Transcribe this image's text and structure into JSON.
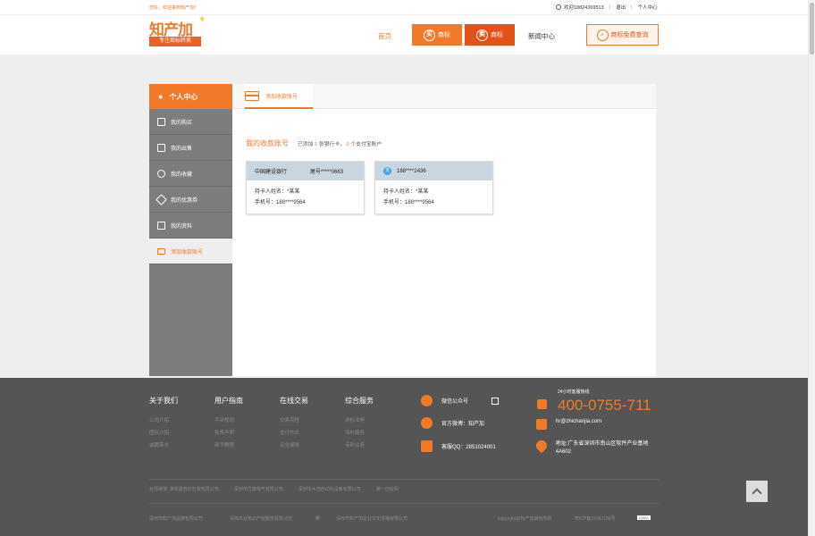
{
  "topbar": {
    "greeting": "您好，欢迎来到知产加！",
    "user_phone": "欢迎18824369513",
    "logout": "退出",
    "personal_center": "个人中心"
  },
  "header": {
    "logo_text": "知产加",
    "logo_slogan": "专注商标转卖",
    "nav_home": "首页",
    "buy_trademark": "商标",
    "buy_icon": "买",
    "sell_trademark": "商标",
    "sell_icon": "卖",
    "news": "新闻中心",
    "free_query": "商标免费查询"
  },
  "sidebar": {
    "title": "个人中心",
    "items": [
      {
        "label": "我的购买",
        "icon": "cart-icon"
      },
      {
        "label": "我的出售",
        "icon": "sell-icon"
      },
      {
        "label": "我的收藏",
        "icon": "heart-icon"
      },
      {
        "label": "我的优惠券",
        "icon": "coupon-icon"
      },
      {
        "label": "我的资料",
        "icon": "profile-icon"
      },
      {
        "label": "添加收款账号",
        "icon": "card-icon"
      }
    ]
  },
  "main": {
    "tab_label": "添加收款账号",
    "account_title": "我的收款账号",
    "summary_prefix": "已添加",
    "bank_count": "1",
    "summary_mid": "张银行卡，",
    "alipay_count": "0",
    "summary_suffix": "个支付宝账户",
    "cards": [
      {
        "bank": "中国建设银行",
        "number": "尾号*****0663",
        "holder": "持卡人姓名：*某某",
        "phone": "手机号：188****9564"
      },
      {
        "bank": "",
        "number": "188****2436",
        "holder": "持卡人姓名：*某某",
        "phone": "手机号：188****9564"
      }
    ]
  },
  "footer": {
    "columns": [
      {
        "title": "关于我们",
        "items": [
          "公司介绍",
          "团队介绍",
          "诚聘英才"
        ]
      },
      {
        "title": "用户指南",
        "items": [
          "平台规则",
          "免责声明",
          "新手教程"
        ]
      },
      {
        "title": "在线交易",
        "items": [
          "交易流程",
          "支付方式",
          "安全保障"
        ]
      },
      {
        "title": "综合服务",
        "items": [
          "商标业务",
          "海外服务",
          "专利业务"
        ]
      }
    ],
    "wechat": "微信公众号",
    "weibo": "官方微博：知产加",
    "qq": "客服QQ：2851024001",
    "hotline_label": "24小时客服热线",
    "hotline": "400-0755-711",
    "email": "hr@zhichanjia.com",
    "address": "地址:广东省深圳市南山区软件产业基地4A602",
    "links": [
      "友情链接: 淮安鑫普达包装有限公司",
      "深圳市优菓电气有限公司",
      "深圳市木浩自动化设备有限公司",
      "第一创业网"
    ],
    "bottom": [
      "深圳市知产加品牌有限公司",
      "深圳市业知识产权服务有限公司",
      "深圳市知产加企业文化传播有限公司",
      "copyright@知产加版权所有",
      "粤ICP备15062158号"
    ]
  }
}
